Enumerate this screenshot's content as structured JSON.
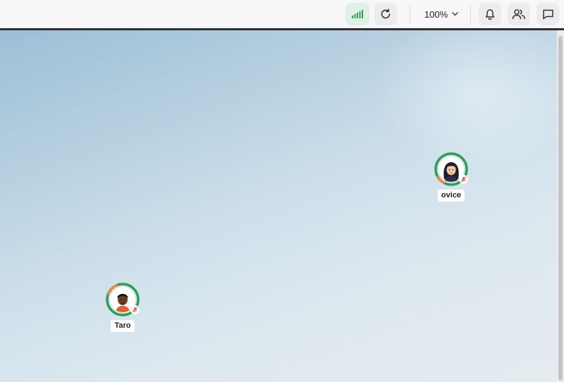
{
  "toolbar": {
    "zoom_label": "100%",
    "icons": [
      "signal-icon",
      "refresh-icon",
      "chevron-down-icon",
      "bell-icon",
      "people-icon",
      "chat-icon"
    ]
  },
  "users": [
    {
      "name": "ovice",
      "avatar": "woman-avatar",
      "status": "available"
    },
    {
      "name": "Taro",
      "avatar": "man-avatar",
      "status": "available"
    }
  ],
  "colors": {
    "status_ring": "#2e9e53",
    "talk_arc": "#f08a3c",
    "signal": "#2e9e53",
    "mic_muted": "#e05050"
  }
}
